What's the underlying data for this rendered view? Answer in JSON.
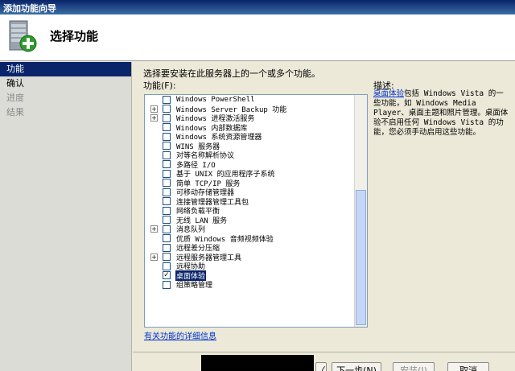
{
  "window": {
    "title": "添加功能向导"
  },
  "header": {
    "title": "选择功能"
  },
  "nav": {
    "items": [
      {
        "label": "功能",
        "state": "active"
      },
      {
        "label": "确认",
        "state": "normal"
      },
      {
        "label": "进度",
        "state": "disabled"
      },
      {
        "label": "结果",
        "state": "disabled"
      }
    ]
  },
  "main": {
    "instruction": "选择要安装在此服务器上的一个或多个功能。",
    "list_label": "功能(F):",
    "description_label": "描述:",
    "description_link": "桌面体验",
    "description_text": "包括 Windows Vista 的一些功能，如 Windows Media Player、桌面主题和照片管理。桌面体验不启用任何 Windows Vista 的功能，您必须手动启用这些功能。",
    "more_info_link": "有关功能的详细信息"
  },
  "features": [
    {
      "label": "Windows PowerShell",
      "expandable": false,
      "checked": false,
      "selected": false
    },
    {
      "label": "Windows Server Backup 功能",
      "expandable": true,
      "checked": false,
      "selected": false
    },
    {
      "label": "Windows 进程激活服务",
      "expandable": true,
      "checked": false,
      "selected": false
    },
    {
      "label": "Windows 内部数据库",
      "expandable": false,
      "checked": false,
      "selected": false
    },
    {
      "label": "Windows 系统资源管理器",
      "expandable": false,
      "checked": false,
      "selected": false
    },
    {
      "label": "WINS 服务器",
      "expandable": false,
      "checked": false,
      "selected": false
    },
    {
      "label": "对等名称解析协议",
      "expandable": false,
      "checked": false,
      "selected": false
    },
    {
      "label": "多路径 I/O",
      "expandable": false,
      "checked": false,
      "selected": false
    },
    {
      "label": "基于 UNIX 的应用程序子系统",
      "expandable": false,
      "checked": false,
      "selected": false
    },
    {
      "label": "简单 TCP/IP 服务",
      "expandable": false,
      "checked": false,
      "selected": false
    },
    {
      "label": "可移动存储管理器",
      "expandable": false,
      "checked": false,
      "selected": false
    },
    {
      "label": "连接管理器管理工具包",
      "expandable": false,
      "checked": false,
      "selected": false
    },
    {
      "label": "网络负载平衡",
      "expandable": false,
      "checked": false,
      "selected": false
    },
    {
      "label": "无线 LAN 服务",
      "expandable": false,
      "checked": false,
      "selected": false
    },
    {
      "label": "消息队列",
      "expandable": true,
      "checked": false,
      "selected": false
    },
    {
      "label": "优质 Windows 音频视频体验",
      "expandable": false,
      "checked": false,
      "selected": false
    },
    {
      "label": "远程差分压缩",
      "expandable": false,
      "checked": false,
      "selected": false
    },
    {
      "label": "远程服务器管理工具",
      "expandable": true,
      "checked": false,
      "selected": false
    },
    {
      "label": "远程协助",
      "expandable": false,
      "checked": false,
      "selected": false
    },
    {
      "label": "桌面体验",
      "expandable": false,
      "checked": true,
      "selected": true
    },
    {
      "label": "组策略管理",
      "expandable": false,
      "checked": false,
      "selected": false
    }
  ],
  "buttons": {
    "prev": "〈",
    "next": "下一步(N) >",
    "install": "安装(I)",
    "cancel": "取消"
  },
  "colors": {
    "selection": "#0a246a",
    "link": "#0033cc"
  }
}
